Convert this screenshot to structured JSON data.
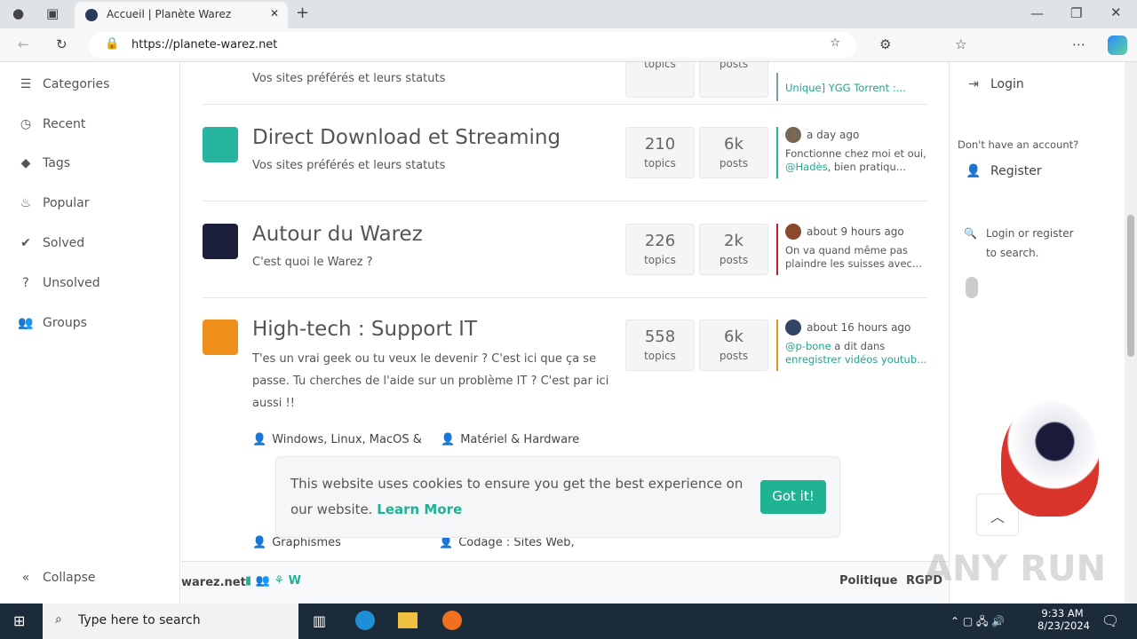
{
  "browser": {
    "tab_title": "Accueil | Planète Warez",
    "url": "https://planete-warez.net"
  },
  "sidebar": {
    "items": [
      {
        "label": "Categories",
        "icon": "list-icon"
      },
      {
        "label": "Recent",
        "icon": "clock-icon"
      },
      {
        "label": "Tags",
        "icon": "tag-icon"
      },
      {
        "label": "Popular",
        "icon": "fire-icon"
      },
      {
        "label": "Solved",
        "icon": "check-icon"
      },
      {
        "label": "Unsolved",
        "icon": "question-icon"
      },
      {
        "label": "Groups",
        "icon": "users-icon"
      }
    ],
    "collapse": "Collapse"
  },
  "categories": [
    {
      "title": "",
      "desc": "Vos sites préférés et leurs statuts",
      "topics_label": "topics",
      "posts_label": "posts",
      "last_text": "Unique] YGG Torrent :...",
      "color": "#7a9aaa"
    },
    {
      "title": "Direct Download et Streaming",
      "desc": "Vos sites préférés et leurs statuts",
      "topics": "210",
      "posts": "6k",
      "topics_label": "topics",
      "posts_label": "posts",
      "time": "a day ago",
      "last_a": "Fonctionne chez moi et oui, ",
      "last_link": "@Hadès",
      "last_b": ", bien pratiqu...",
      "color": "#1fb394"
    },
    {
      "title": "Autour du Warez",
      "desc": "C'est quoi le Warez ?",
      "topics": "226",
      "posts": "2k",
      "topics_label": "topics",
      "posts_label": "posts",
      "time": "about 9 hours ago",
      "last_a": "On va quand même pas plaindre les suisses avec...",
      "color": "#c0202a"
    },
    {
      "title": "High-tech : Support IT",
      "desc": "T'es un vrai geek ou tu veux le devenir ? C'est ici que ça se passe. Tu cherches de l'aide sur un problème IT ? C'est par ici aussi !!",
      "topics": "558",
      "posts": "6k",
      "topics_label": "topics",
      "posts_label": "posts",
      "time": "about 16 hours ago",
      "last_link": "@p-bone",
      "last_a": " a dit dans ",
      "last_link2": "enregistrer vidéos youtub...",
      "color": "#f0901c"
    }
  ],
  "subcategories": [
    "Windows, Linux, MacOS &",
    "Matériel & Hardware",
    "Graphismes",
    "Codage : Sites Web,"
  ],
  "footer": {
    "site": "warez.net",
    "links": [
      "Politique",
      "RGPD"
    ]
  },
  "right": {
    "login": "Login",
    "no_account": "Don't have an account?",
    "register": "Register",
    "search_hint": "Login or register to search."
  },
  "cookie": {
    "text": "This website uses cookies to ensure you get the best experience on our website.",
    "learn_more": "Learn More",
    "button": "Got it!"
  },
  "taskbar": {
    "search_placeholder": "Type here to search",
    "time": "9:33 AM",
    "date": "8/23/2024"
  },
  "watermark": "ANY RUN",
  "accent": "#1fb394"
}
